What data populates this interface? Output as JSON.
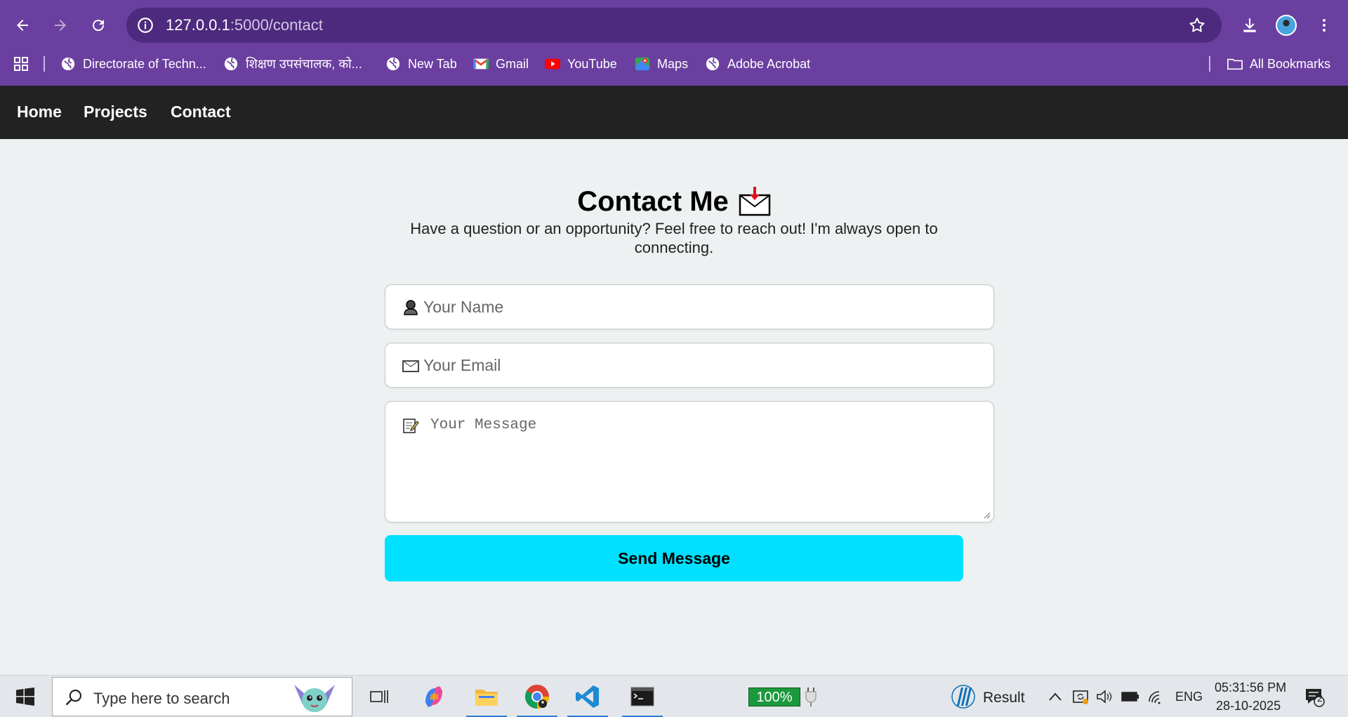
{
  "browser": {
    "url_host": "127.0.0.1",
    "url_path": ":5000/contact",
    "bookmarks": [
      {
        "label": "Directorate of Techn...",
        "icon": "globe-icon"
      },
      {
        "label": "शिक्षण उपसंचालक, को...",
        "icon": "globe-icon"
      },
      {
        "label": "New Tab",
        "icon": "globe-icon"
      },
      {
        "label": "Gmail",
        "icon": "gmail-icon"
      },
      {
        "label": "YouTube",
        "icon": "youtube-icon"
      },
      {
        "label": "Maps",
        "icon": "maps-icon"
      },
      {
        "label": "Adobe Acrobat",
        "icon": "globe-icon"
      }
    ],
    "all_bookmarks": "All Bookmarks"
  },
  "nav": {
    "home": "Home",
    "projects": "Projects",
    "contact": "Contact"
  },
  "contact": {
    "title": "Contact Me",
    "subtitle": "Have a question or an opportunity? Feel free to reach out! I'm always open to connecting.",
    "name_placeholder": "Your Name",
    "email_placeholder": "Your Email",
    "message_placeholder": "Your Message",
    "send_label": "Send Message"
  },
  "taskbar": {
    "search_placeholder": "Type here to search",
    "battery": "100%",
    "result_label": "Result",
    "language": "ENG",
    "time": "05:31:56 PM",
    "date": "28-10-2025",
    "notifications": "2"
  },
  "colors": {
    "browser_frame": "#6b3fa0",
    "site_nav": "#222222",
    "send_button": "#00e1ff",
    "page_bg": "#eef1f2"
  }
}
